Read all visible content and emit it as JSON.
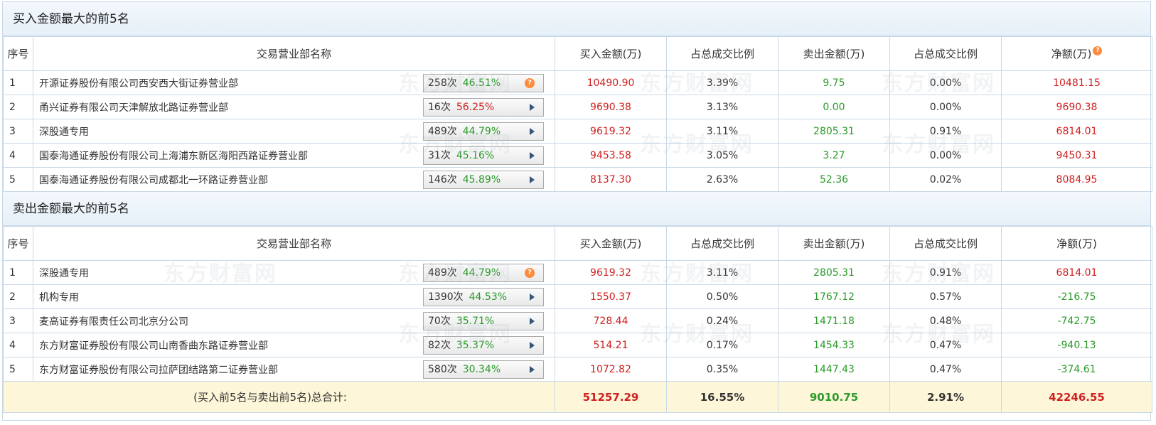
{
  "buy_top5": {
    "title": "买入金额最大的前5名",
    "headers": [
      "序号",
      "交易营业部名称",
      "买入金额(万)",
      "占总成交比例",
      "卖出金额(万)",
      "占总成交比例",
      "净额(万)"
    ],
    "rows": [
      {
        "idx": "1",
        "name": "开源证券股份有限公司西安西大街证券营业部",
        "count": "258次",
        "pct": "46.51%",
        "pct_color": "green",
        "icon": "help",
        "buy": "10490.90",
        "buy_ratio": "3.39%",
        "sell": "9.75",
        "sell_ratio": "0.00%",
        "net": "10481.15"
      },
      {
        "idx": "2",
        "name": "甬兴证券有限公司天津解放北路证券营业部",
        "count": "16次",
        "pct": "56.25%",
        "pct_color": "red",
        "icon": "arrow",
        "buy": "9690.38",
        "buy_ratio": "3.13%",
        "sell": "0.00",
        "sell_ratio": "0.00%",
        "net": "9690.38"
      },
      {
        "idx": "3",
        "name": "深股通专用",
        "count": "489次",
        "pct": "44.79%",
        "pct_color": "green",
        "icon": "arrow",
        "buy": "9619.32",
        "buy_ratio": "3.11%",
        "sell": "2805.31",
        "sell_ratio": "0.91%",
        "net": "6814.01"
      },
      {
        "idx": "4",
        "name": "国泰海通证券股份有限公司上海浦东新区海阳西路证券营业部",
        "count": "31次",
        "pct": "45.16%",
        "pct_color": "green",
        "icon": "arrow",
        "buy": "9453.58",
        "buy_ratio": "3.05%",
        "sell": "3.27",
        "sell_ratio": "0.00%",
        "net": "9450.31"
      },
      {
        "idx": "5",
        "name": "国泰海通证券股份有限公司成都北一环路证券营业部",
        "count": "146次",
        "pct": "45.89%",
        "pct_color": "green",
        "icon": "arrow",
        "buy": "8137.30",
        "buy_ratio": "2.63%",
        "sell": "52.36",
        "sell_ratio": "0.02%",
        "net": "8084.95"
      }
    ]
  },
  "sell_top5": {
    "title": "卖出金额最大的前5名",
    "headers": [
      "序号",
      "交易营业部名称",
      "买入金额(万)",
      "占总成交比例",
      "卖出金额(万)",
      "占总成交比例",
      "净额(万)"
    ],
    "rows": [
      {
        "idx": "1",
        "name": "深股通专用",
        "count": "489次",
        "pct": "44.79%",
        "pct_color": "green",
        "icon": "help",
        "buy": "9619.32",
        "buy_ratio": "3.11%",
        "sell": "2805.31",
        "sell_ratio": "0.91%",
        "net": "6814.01"
      },
      {
        "idx": "2",
        "name": "机构专用",
        "count": "1390次",
        "pct": "44.53%",
        "pct_color": "green",
        "icon": "arrow",
        "buy": "1550.37",
        "buy_ratio": "0.50%",
        "sell": "1767.12",
        "sell_ratio": "0.57%",
        "net": "-216.75"
      },
      {
        "idx": "3",
        "name": "麦高证券有限责任公司北京分公司",
        "count": "70次",
        "pct": "35.71%",
        "pct_color": "green",
        "icon": "arrow",
        "buy": "728.44",
        "buy_ratio": "0.24%",
        "sell": "1471.18",
        "sell_ratio": "0.48%",
        "net": "-742.75"
      },
      {
        "idx": "4",
        "name": "东方财富证券股份有限公司山南香曲东路证券营业部",
        "count": "82次",
        "pct": "35.37%",
        "pct_color": "green",
        "icon": "arrow",
        "buy": "514.21",
        "buy_ratio": "0.17%",
        "sell": "1454.33",
        "sell_ratio": "0.47%",
        "net": "-940.13"
      },
      {
        "idx": "5",
        "name": "东方财富证券股份有限公司拉萨团结路第二证券营业部",
        "count": "580次",
        "pct": "30.34%",
        "pct_color": "green",
        "icon": "arrow",
        "buy": "1072.82",
        "buy_ratio": "0.35%",
        "sell": "1447.43",
        "sell_ratio": "0.47%",
        "net": "-374.61"
      }
    ]
  },
  "total": {
    "label": "(买入前5名与卖出前5名)总合计:",
    "buy": "51257.29",
    "buy_ratio": "16.55%",
    "sell": "9010.75",
    "sell_ratio": "2.91%",
    "net": "42246.55"
  },
  "icons": {
    "help": "?",
    "arrow": "play-arrow-icon"
  },
  "watermark": "东方财富网",
  "colors": {
    "positive": "#d01f1f",
    "negative": "#2a9a2a",
    "header_bg": "#e6f0f8",
    "border": "#c9d8e6",
    "total_bg": "#fdf6d9",
    "help_icon": "#ff8a3a"
  }
}
